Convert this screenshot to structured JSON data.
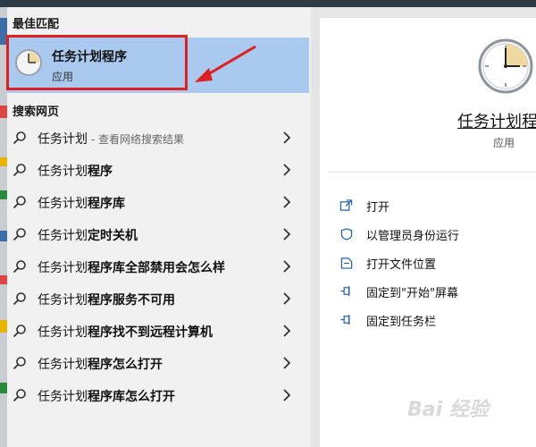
{
  "best_match": {
    "heading": "最佳匹配",
    "name": "任务计划程序",
    "type": "应用"
  },
  "web_search": {
    "heading": "搜索网页",
    "items": [
      {
        "prefix": "任务计划",
        "suffix": "",
        "sub": " - 查看网络搜索结果"
      },
      {
        "prefix": "任务计划",
        "suffix": "程序",
        "sub": ""
      },
      {
        "prefix": "任务计划",
        "suffix": "程序库",
        "sub": ""
      },
      {
        "prefix": "任务计划",
        "suffix": "定时关机",
        "sub": ""
      },
      {
        "prefix": "任务计划",
        "suffix": "程序库全部禁用会怎么样",
        "sub": ""
      },
      {
        "prefix": "任务计划",
        "suffix": "程序服务不可用",
        "sub": ""
      },
      {
        "prefix": "任务计划",
        "suffix": "程序找不到远程计算机",
        "sub": ""
      },
      {
        "prefix": "任务计划",
        "suffix": "程序怎么打开",
        "sub": ""
      },
      {
        "prefix": "任务计划",
        "suffix": "程序库怎么打开",
        "sub": ""
      }
    ]
  },
  "detail": {
    "title": "任务计划程",
    "type": "应用",
    "actions": [
      {
        "label": "打开",
        "icon": "open-icon"
      },
      {
        "label": "以管理员身份运行",
        "icon": "shield-icon"
      },
      {
        "label": "打开文件位置",
        "icon": "file-location-icon"
      },
      {
        "label": "固定到\"开始\"屏幕",
        "icon": "pin-icon"
      },
      {
        "label": "固定到任务栏",
        "icon": "pin-icon"
      }
    ]
  },
  "colors": {
    "selected_bg": "#a9c9ee",
    "annotation_red": "#e02020",
    "link_blue": "#1a5fb4"
  }
}
